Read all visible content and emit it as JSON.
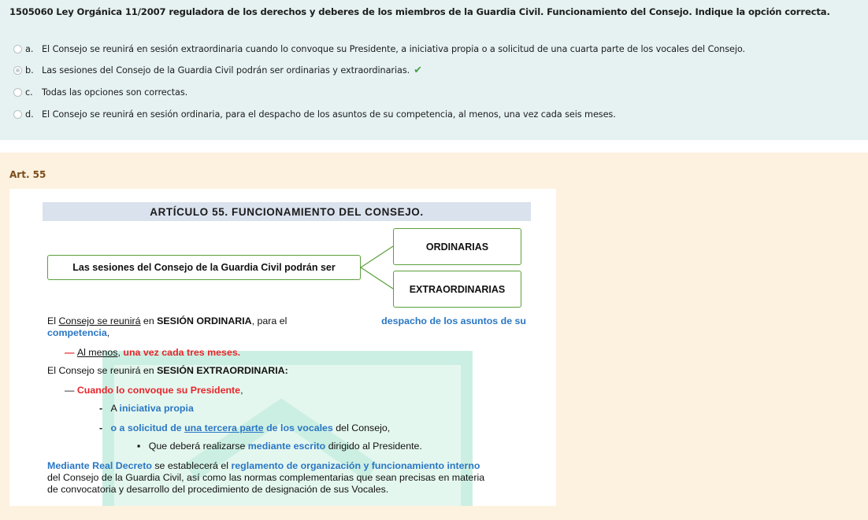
{
  "question": {
    "text": "1505060 Ley Orgánica 11/2007 reguladora de los derechos y deberes de los miembros de la Guardia Civil. Funcionamiento del Consejo. Indique la opción correcta.",
    "options": [
      {
        "letter": "a.",
        "text": "El Consejo se reunirá en sesión extraordinaria cuando lo convoque su Presidente, a iniciativa propia o a solicitud de una cuarta parte de los vocales del Consejo.",
        "selected": false
      },
      {
        "letter": "b.",
        "text": "Las sesiones del Consejo de la Guardia Civil podrán ser ordinarias y extraordinarias.",
        "selected": true,
        "correct": true
      },
      {
        "letter": "c.",
        "text": "Todas las opciones son correctas.",
        "selected": false
      },
      {
        "letter": "d.",
        "text": "El Consejo se reunirá en sesión ordinaria, para el despacho de los asuntos de su competencia, al menos, una vez cada seis meses.",
        "selected": false
      }
    ]
  },
  "feedback": {
    "reference": "Art. 55"
  },
  "article": {
    "title": "ARTÍCULO 55. FUNCIONAMIENTO DEL CONSEJO.",
    "diagram": {
      "source": "Las sesiones del Consejo de la Guardia Civil podrán ser",
      "top": "ORDINARIAS",
      "bottom": "EXTRAORDINARIAS"
    },
    "p1": {
      "a": "El ",
      "b": "Consejo se reunirá",
      "c": " en ",
      "d": "SESIÓN ORDINARIA",
      "e": ", para el ",
      "f": "despacho de los asuntos de su",
      "g": "competencia",
      "h": ","
    },
    "p1_bullet": {
      "dash": "—",
      "a": "Al menos",
      "b": ",",
      "c": " una vez cada tres meses."
    },
    "p2": {
      "a": "El Consejo se reunirá en ",
      "b": "SESIÓN EXTRAORDINARIA:"
    },
    "p2_bullet": {
      "dash": "—",
      "a": "Cuando lo convoque su Presidente",
      "b": ","
    },
    "sub1": {
      "dash": "-",
      "a": "A ",
      "b": "iniciativa propia"
    },
    "sub2": {
      "dash": "-",
      "a": "o a solicitud de ",
      "b": "una tercera parte",
      "c": " de los vocales",
      "d": " del Consejo,"
    },
    "sub3": {
      "bullet": "▪",
      "a": "Que deberá realizarse ",
      "b": "mediante escrito",
      "c": " dirigido al Presidente."
    },
    "p3": {
      "a": "Mediante Real Decreto",
      "b": " se establecerá el ",
      "c": "reglamento de organización y funcionamiento interno",
      "line2": "del Consejo de la Guardia Civil, así como las normas complementarias que sean precisas en materia",
      "line3": "de convocatoria y desarrollo del procedimiento de designación de sus Vocales."
    }
  },
  "colors": {
    "question_bg": "#e6f2f2",
    "feedback_bg": "#fdf1e0",
    "check": "#4aa047",
    "blue_text": "#2a77c4",
    "red_text": "#e8252b",
    "box_border": "#5a9f3a"
  }
}
